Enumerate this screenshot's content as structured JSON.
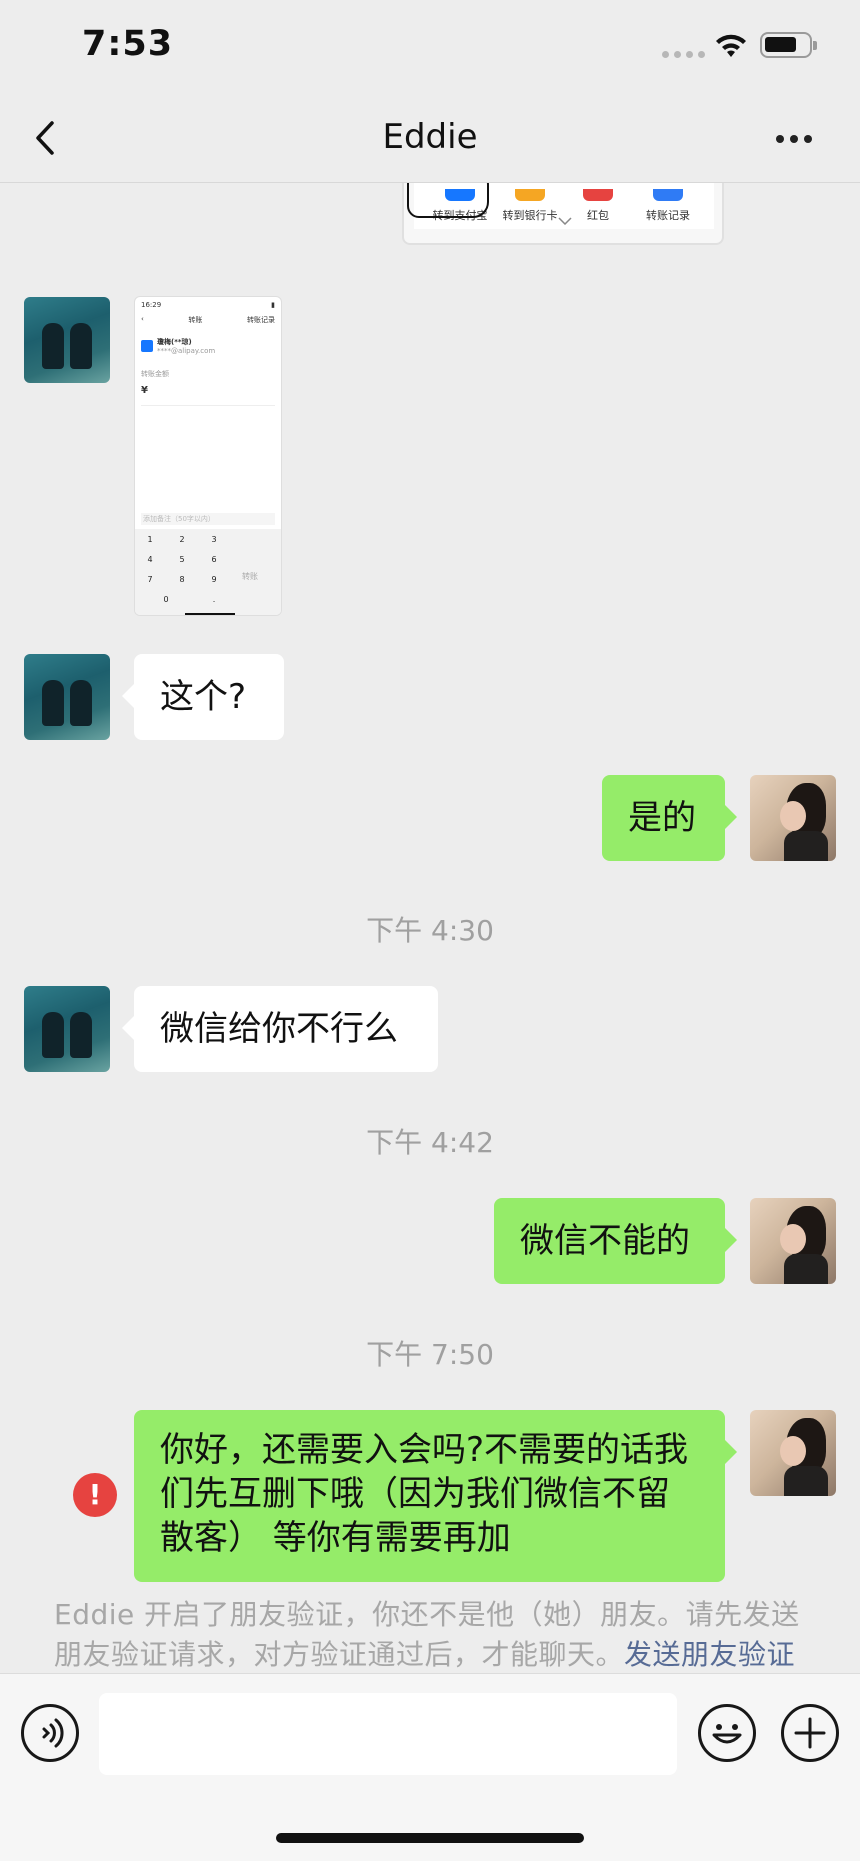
{
  "status_bar": {
    "time": "7:53",
    "icons": [
      "signal-icon",
      "wifi-icon",
      "battery-icon"
    ]
  },
  "nav": {
    "title": "Eddie",
    "back_icon": "chevron-left-icon",
    "more_icon": "more-dots-icon"
  },
  "shared_screenshot_top": {
    "items": [
      {
        "label": "转到支付宝",
        "icon": "alipay-icon",
        "color": "#1677ff"
      },
      {
        "label": "转到银行卡",
        "icon": "bank-card-icon",
        "color": "#f5a623"
      },
      {
        "label": "红包",
        "icon": "red-packet-icon",
        "color": "#e64340"
      },
      {
        "label": "转账记录",
        "icon": "record-icon",
        "color": "#2f7bf5"
      }
    ]
  },
  "shared_screenshot_phone": {
    "status_time": "16:29",
    "title": "转账",
    "header_right": "转账记录",
    "recipient_name": "瓊梅(**琼)",
    "recipient_sub": "****@alipay.com",
    "amount_label": "转账金额",
    "currency": "¥",
    "remark_placeholder": "添加备注（50字以内）",
    "keys": [
      "1",
      "2",
      "3",
      "4",
      "5",
      "6",
      "7",
      "8",
      "9",
      "0",
      "."
    ],
    "confirm_label": "转账"
  },
  "messages": [
    {
      "side": "left",
      "text": "这个?"
    },
    {
      "side": "right",
      "text": "是的"
    },
    {
      "side": "left",
      "text": "微信给你不行么"
    },
    {
      "side": "right",
      "text": "微信不能的"
    },
    {
      "side": "right",
      "text": "你好，还需要入会吗?不需要的话我们先互删下哦（因为我们微信不留散客） 等你有需要再加",
      "status": "failed"
    }
  ],
  "timestamps": [
    "下午 4:30",
    "下午 4:42",
    "下午 7:50"
  ],
  "system_note": {
    "text": "Eddie 开启了朋友验证，你还不是他（她）朋友。请先发送朋友验证请求，对方验证通过后，才能聊天。",
    "link": "发送朋友验证"
  },
  "input_bar": {
    "voice_icon": "voice-icon",
    "emoji_icon": "emoji-icon",
    "add_icon": "plus-icon",
    "placeholder": ""
  }
}
